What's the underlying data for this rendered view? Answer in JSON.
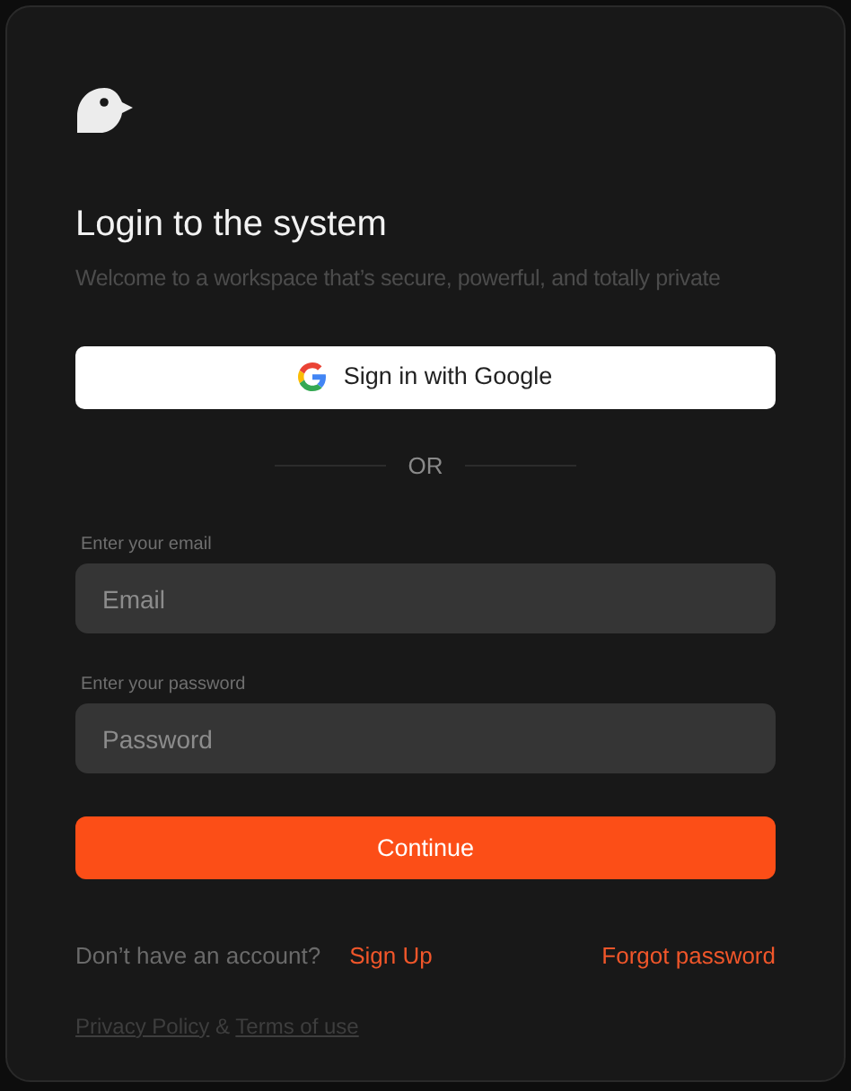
{
  "title": "Login to the system",
  "subtitle": "Welcome to a workspace that’s secure, powerful, and totally private",
  "google_button": "Sign in with Google",
  "divider": "OR",
  "fields": [
    {
      "label": "Enter your email",
      "placeholder": "Email"
    },
    {
      "label": "Enter your password",
      "placeholder": "Password"
    }
  ],
  "submit_button": "Continue",
  "signup_prompt": "Don’t have an account?",
  "signup_link": "Sign Up",
  "forgot_link": "Forgot password",
  "footer": {
    "links": [
      "Privacy Policy",
      "Terms of use"
    ],
    "separator": "&"
  }
}
